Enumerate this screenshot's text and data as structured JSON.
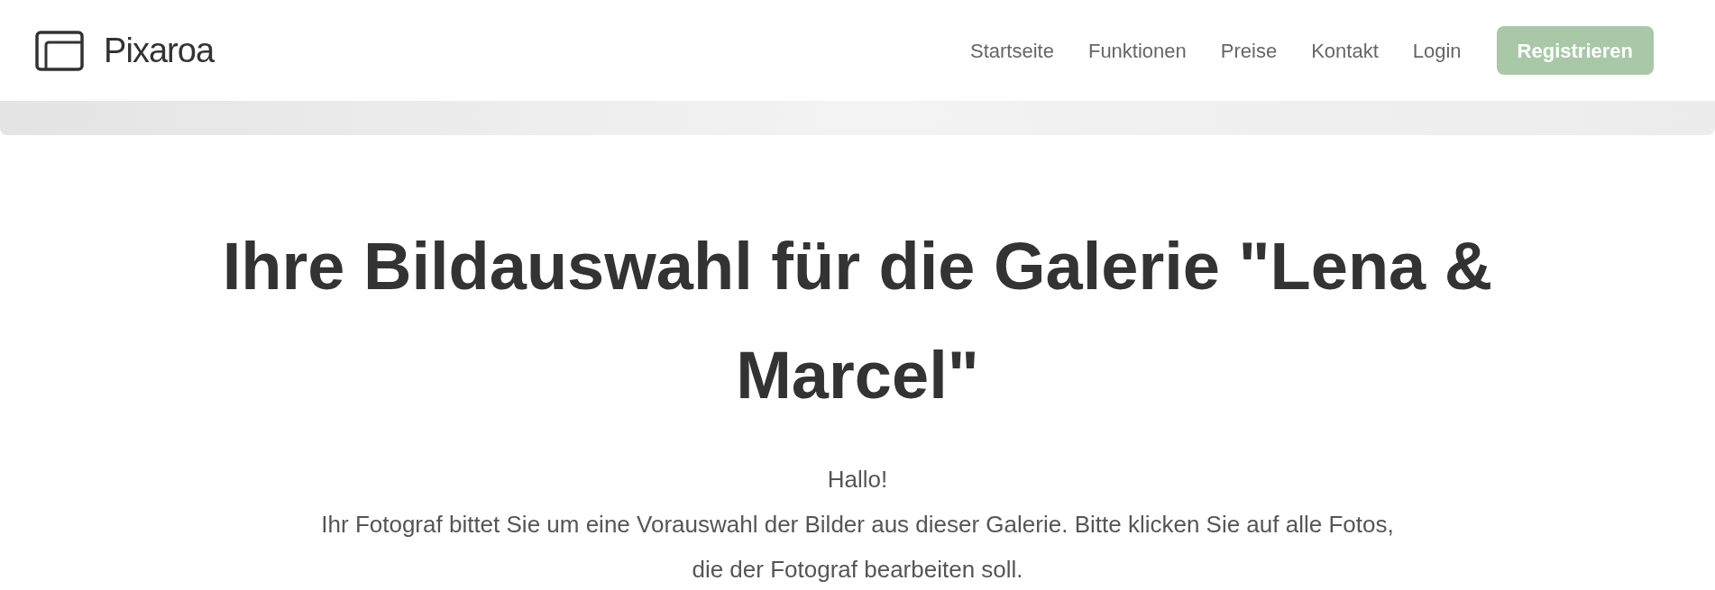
{
  "header": {
    "logo_text": "Pixaroa",
    "nav": [
      {
        "label": "Startseite"
      },
      {
        "label": "Funktionen"
      },
      {
        "label": "Preise"
      },
      {
        "label": "Kontakt"
      },
      {
        "label": "Login"
      }
    ],
    "cta": "Registrieren"
  },
  "main": {
    "title": "Ihre Bildauswahl für die Galerie \"Lena & Marcel\"",
    "greeting": "Hallo!",
    "intro": "Ihr Fotograf bittet Sie um eine Vorauswahl der Bilder aus dieser Galerie. Bitte klicken Sie auf alle Fotos, die der Fotograf bearbeiten soll."
  }
}
